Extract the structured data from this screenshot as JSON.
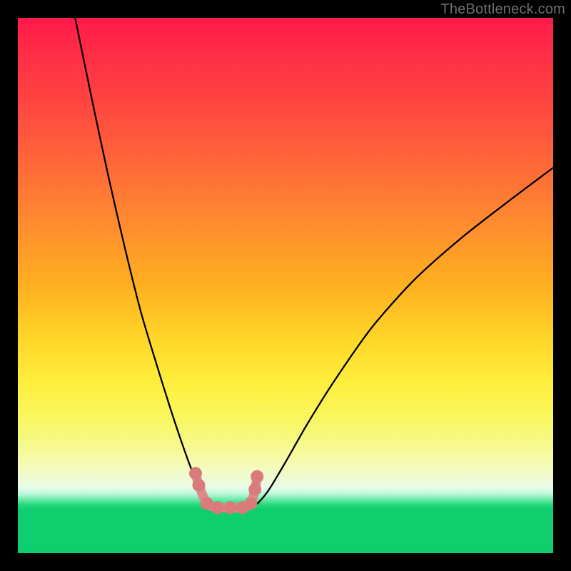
{
  "watermark": "TheBottleneck.com",
  "chart_data": {
    "type": "line",
    "title": "",
    "xlabel": "",
    "ylabel": "",
    "xlim": [
      0,
      100
    ],
    "ylim": [
      0,
      100
    ],
    "grid": false,
    "legend": false,
    "series": [
      {
        "name": "left-branch",
        "x": [
          10.7,
          14,
          17,
          20,
          23,
          26,
          28.5,
          30.5,
          32.3,
          34,
          35.3,
          36.5,
          37.6,
          38.5
        ],
        "y": [
          100,
          84,
          70,
          57,
          45,
          35,
          27,
          21,
          16,
          12,
          10,
          9,
          8.5,
          8.5
        ]
      },
      {
        "name": "right-branch",
        "x": [
          43.5,
          45,
          47,
          50,
          54,
          59,
          66,
          74,
          83,
          92,
          100
        ],
        "y": [
          8.5,
          9.5,
          12,
          17,
          24,
          32,
          42,
          51,
          59,
          66,
          72
        ]
      },
      {
        "name": "valley-markers",
        "x": [
          33.2,
          33.8,
          35.3,
          37.3,
          39.7,
          42.0,
          43.5,
          44.3,
          44.7
        ],
        "y": [
          14.9,
          12.7,
          9.3,
          8.5,
          8.5,
          8.5,
          9.3,
          11.9,
          14.3
        ]
      }
    ],
    "colors": {
      "curve": "#000000",
      "marker_stroke": "#e08a8a",
      "marker_fill": "#d97b7b"
    },
    "background_gradient": {
      "direction": "vertical",
      "stops": [
        {
          "pos": 0.0,
          "color": "#ff1a4a"
        },
        {
          "pos": 0.5,
          "color": "#ffb020"
        },
        {
          "pos": 0.75,
          "color": "#f6f98f"
        },
        {
          "pos": 0.9,
          "color": "#6be9a6"
        },
        {
          "pos": 1.0,
          "color": "#0dce6d"
        }
      ]
    }
  }
}
